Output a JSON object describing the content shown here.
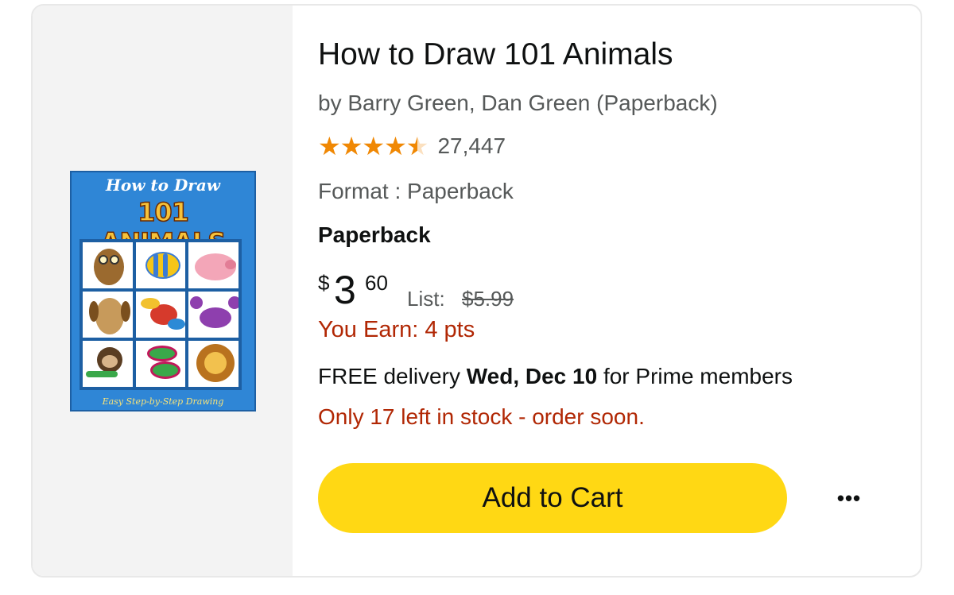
{
  "product": {
    "title": "How to Draw 101 Animals",
    "byline": "by Barry Green, Dan Green (Paperback)",
    "rating": {
      "stars": 4.5,
      "max": 5,
      "stars_glyph": "★★★★★",
      "count": "27,447"
    },
    "format": "Format : Paperback",
    "binding": "Paperback",
    "price": {
      "symbol": "$",
      "whole": "3",
      "fraction": "60",
      "list_label": "List:",
      "list_price": "$5.99"
    },
    "earn": "You Earn: 4 pts",
    "delivery": {
      "prefix": "FREE delivery",
      "date": "Wed, Dec 10",
      "suffix": "for Prime members"
    },
    "stock": "Only 17 left in stock - order soon.",
    "cover": {
      "title_small": "How to Draw",
      "title_big": "101 ANIMALS",
      "footer": "Easy Step-by-Step Drawing"
    }
  },
  "actions": {
    "add_to_cart": "Add to Cart",
    "more": "•••"
  },
  "colors": {
    "star": "#f08804",
    "price_alert": "#b12704",
    "cart_button": "#ffd814",
    "panel_bg": "#f3f3f3",
    "cover_bg": "#2f86d6"
  },
  "icons": {
    "rating": "star-icon",
    "more": "more-options-icon"
  }
}
